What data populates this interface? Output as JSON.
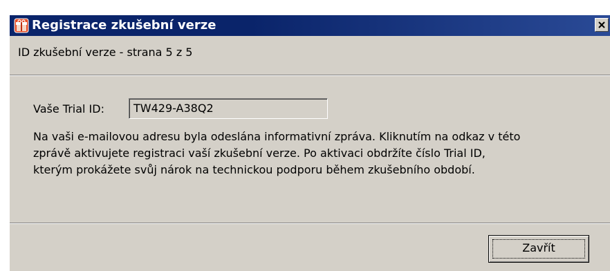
{
  "window": {
    "title": "Registrace zkušební verze",
    "app_icon": "gift-icon",
    "close_icon": "close-icon"
  },
  "step": {
    "label": "ID zkušební verze - strana 5 z 5"
  },
  "trial": {
    "label": "Vaše Trial ID:",
    "value": "TW429-A38Q2"
  },
  "message": {
    "lines": [
      "Na vaši e-mailovou adresu byla odeslána informativní zpráva. Kliknutím na odkaz v této",
      "zprávě aktivujete registraci vaší zkušební verze. Po aktivaci obdržíte číslo Trial ID,",
      "kterým prokážete svůj nárok na technickou podporu během zkušebního období."
    ]
  },
  "buttons": {
    "close_label": "Zavřít"
  },
  "colors": {
    "titlebar": "#0a246a",
    "face": "#d4d0c8"
  }
}
